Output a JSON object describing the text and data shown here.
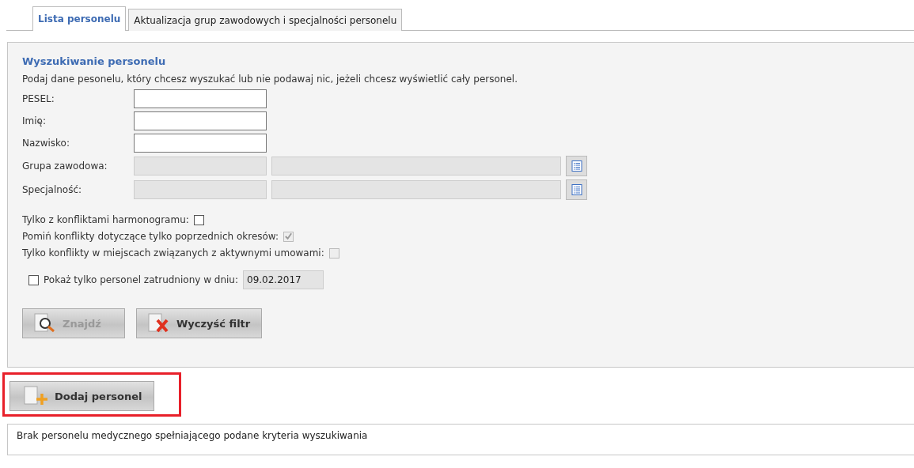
{
  "tabs": [
    {
      "label": "Lista personelu",
      "selected": true
    },
    {
      "label": "Aktualizacja grup zawodowych i specjalności personelu",
      "selected": false
    }
  ],
  "search_panel": {
    "title": "Wyszukiwanie personelu",
    "description": "Podaj dane pesonelu, który chcesz wyszukać lub nie podawaj nic, jeżeli chcesz wyświetlić cały personel.",
    "fields": [
      {
        "kind": "text",
        "label": "PESEL:"
      },
      {
        "kind": "text",
        "label": "Imię:"
      },
      {
        "kind": "text",
        "label": "Nazwisko:"
      },
      {
        "kind": "picker",
        "label": "Grupa zawodowa:"
      },
      {
        "kind": "picker",
        "label": "Specjalność:"
      }
    ],
    "options": [
      {
        "label": "Tylko z konfliktami harmonogramu:",
        "checked": false,
        "disabled": false
      },
      {
        "label": "Pomiń konflikty dotyczące tylko poprzednich okresów:",
        "checked": true,
        "disabled": true
      },
      {
        "label": "Tylko konflikty w miejscach związanych z aktywnymi umowami:",
        "checked": false,
        "disabled": true
      }
    ],
    "employed_filter": {
      "label": "Pokaż tylko personel zatrudniony w dniu:",
      "checked": false,
      "date": "09.02.2017"
    },
    "buttons": [
      {
        "kind": "search",
        "label": "Znajdź",
        "disabled": true
      },
      {
        "kind": "clear",
        "label": "Wyczyść filtr",
        "disabled": false
      }
    ]
  },
  "add_button": {
    "label": "Dodaj personel",
    "highlighted": true
  },
  "result_message": "Brak personelu medycznego spełniającego podane kryteria wyszukiwania"
}
